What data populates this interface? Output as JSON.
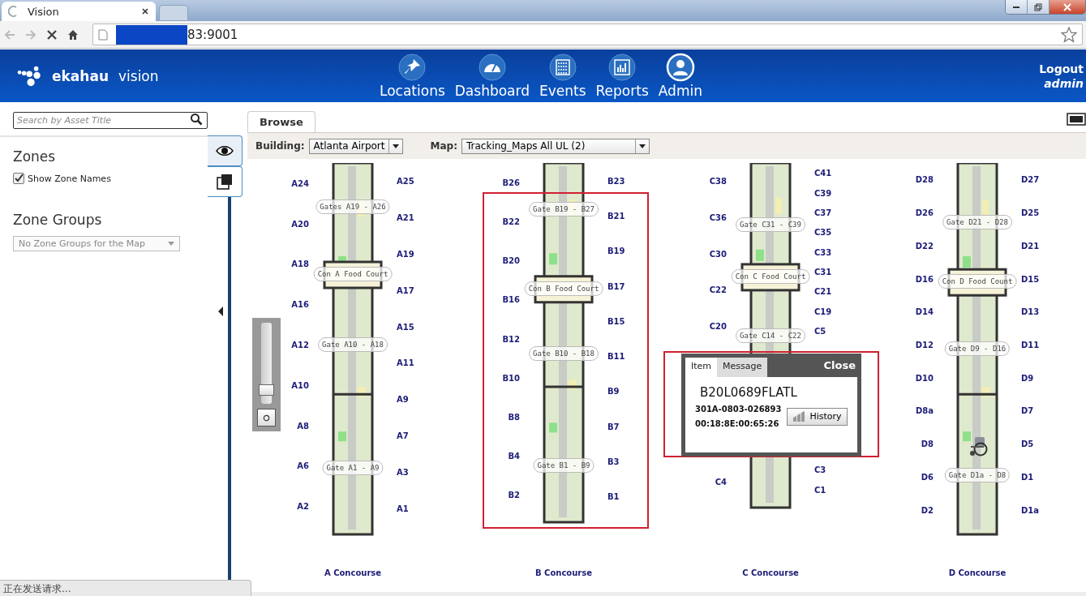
{
  "browser": {
    "tab_title": "Vision",
    "url": "83:9001",
    "status": "正在发送请求..."
  },
  "header": {
    "logo": "ekahau",
    "product": "vision",
    "logout": "Logout",
    "user": "admin",
    "nav": [
      {
        "label": "Locations",
        "kind": "pin",
        "selected": false
      },
      {
        "label": "Dashboard",
        "kind": "gauge",
        "selected": false
      },
      {
        "label": "Events",
        "kind": "list",
        "selected": false
      },
      {
        "label": "Reports",
        "kind": "chart",
        "selected": false
      },
      {
        "label": "Admin",
        "kind": "person",
        "selected": true
      }
    ]
  },
  "sidebar": {
    "search": {
      "placeholder": "Search by Asset Title"
    },
    "tabs": [
      {
        "kind": "eye",
        "selected": true
      },
      {
        "kind": "layers",
        "selected": false
      }
    ],
    "zones": {
      "title": "Zones",
      "show_names": {
        "label": "Show Zone Names",
        "checked": true
      }
    },
    "zone_groups": {
      "title": "Zone Groups",
      "select": "No Zone Groups for the Map"
    }
  },
  "main": {
    "tabs": [
      {
        "label": "Browse",
        "selected": true
      }
    ],
    "building": {
      "label": "Building:",
      "value": "Atlanta Airport"
    },
    "map": {
      "label": "Map:",
      "value": "Tracking_Maps All UL (2)"
    },
    "zoom": {
      "level": 0.1
    },
    "concourses": [
      {
        "title": "A Concourse",
        "highlighted": false,
        "has_asset": false,
        "left_gates": [
          "A24",
          "A20",
          "A18",
          "A16",
          "A12",
          "A10",
          "A8",
          "A6",
          "A2"
        ],
        "right_gates": [
          "A25",
          "A21",
          "A19",
          "A17",
          "A15",
          "A11",
          "A9",
          "A7",
          "A3",
          "A1"
        ],
        "zones": [
          "Gates A19 - A26",
          "Con A Food Court",
          "Gate A10 - A18",
          "Gate A1 - A9"
        ]
      },
      {
        "title": "B Concourse",
        "highlighted": true,
        "has_asset": false,
        "left_gates": [
          "B26",
          "B22",
          "B20",
          "B16",
          "B12",
          "B10",
          "B8",
          "B4",
          "B2"
        ],
        "right_gates": [
          "B23",
          "B21",
          "B19",
          "B17",
          "B15",
          "B11",
          "B9",
          "B7",
          "B3",
          "B1"
        ],
        "zones": [
          "Gate B19 - B27",
          "Con B Food Court",
          "Gate B10 - B18",
          "Gate B1 - B9"
        ]
      },
      {
        "title": "C Concourse",
        "highlighted": false,
        "has_asset": false,
        "left_gates": [
          "C38",
          "C36",
          "C30",
          "C22",
          "C20",
          "C4"
        ],
        "right_gates": [
          "C41",
          "C39",
          "C37",
          "C35",
          "C33",
          "C31",
          "C21",
          "C19",
          "C5",
          "C3",
          "C1"
        ],
        "zones": [
          "Gate C31 - C39",
          "Con C Food Court",
          "Gate C14 - C22"
        ]
      },
      {
        "title": "D Concourse",
        "highlighted": false,
        "has_asset": true,
        "left_gates": [
          "D28",
          "D26",
          "D22",
          "D16",
          "D14",
          "D12",
          "D10",
          "D8a",
          "D8",
          "D6",
          "D2"
        ],
        "right_gates": [
          "D27",
          "D25",
          "D21",
          "D15",
          "D13",
          "D11",
          "D9",
          "D7",
          "D5",
          "D1",
          "D1a"
        ],
        "zones": [
          "Gate D21 - D28",
          "Con D Food Count",
          "Gate D9 - D16",
          "Gate D1a - D8"
        ]
      }
    ],
    "popup": {
      "highlighted": true,
      "tabs": [
        {
          "label": "Item",
          "selected": true
        },
        {
          "label": "Message",
          "selected": false
        }
      ],
      "close": "Close",
      "title": "B20L0689FLATL",
      "lines": [
        "301A-0803-026893",
        "00:18:8E:00:65:26"
      ],
      "button": "History"
    }
  }
}
